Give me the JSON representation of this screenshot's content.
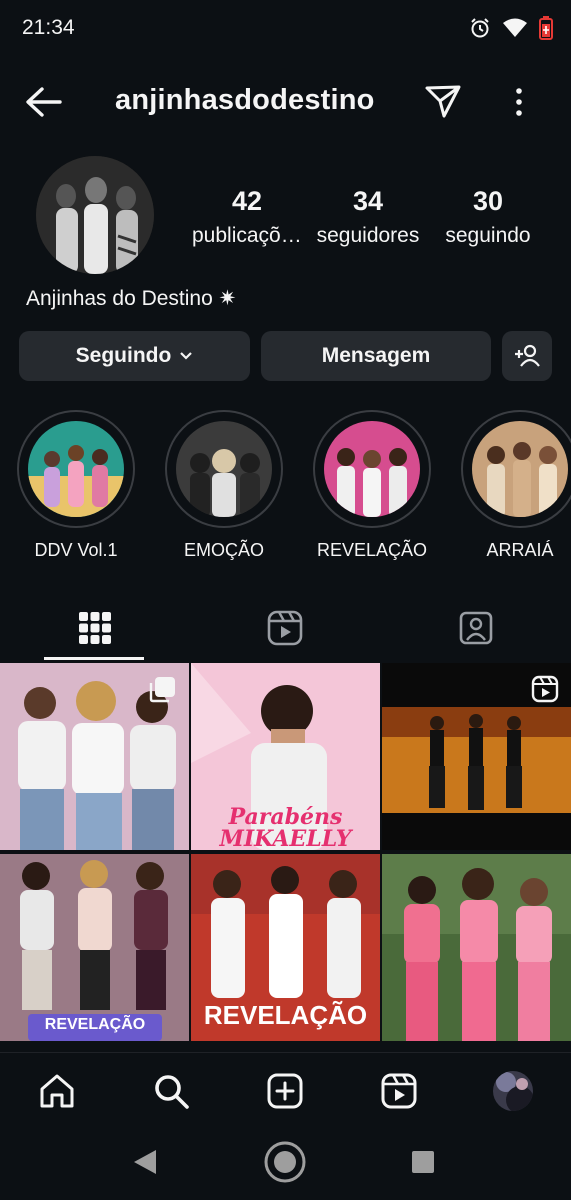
{
  "status_bar": {
    "time": "21:34",
    "icons": [
      "alarm-icon",
      "wifi-icon",
      "battery-icon"
    ]
  },
  "header": {
    "username": "anjinhasdodestino",
    "icons": [
      "back-arrow-icon",
      "send-icon",
      "more-vertical-icon"
    ]
  },
  "profile": {
    "display_name": "Anjinhas do Destino ✷",
    "stats": [
      {
        "value": "42",
        "label": "publicações"
      },
      {
        "value": "34",
        "label": "seguidores"
      },
      {
        "value": "30",
        "label": "seguindo"
      }
    ]
  },
  "actions": {
    "follow_label": "Seguindo",
    "message_label": "Mensagem"
  },
  "highlights": [
    {
      "label": "DDV Vol.1"
    },
    {
      "label": "EMOÇÃO"
    },
    {
      "label": "REVELAÇÃO"
    },
    {
      "label": "ARRAIÁ"
    }
  ],
  "tabs": [
    "grid-icon",
    "reels-icon",
    "tagged-icon"
  ],
  "posts": [
    {
      "caption": ""
    },
    {
      "caption": "Parabéns MIKAELLY"
    },
    {
      "caption": ""
    },
    {
      "caption": "REVELAÇÃO"
    },
    {
      "caption": "REVELAÇÃO"
    },
    {
      "caption": ""
    }
  ],
  "bottom_nav": [
    "home-icon",
    "search-icon",
    "create-icon",
    "reels-icon",
    "profile-avatar"
  ],
  "colors": {
    "background": "#0c1014",
    "button": "#262a2f",
    "text": "#f5f5f5"
  }
}
